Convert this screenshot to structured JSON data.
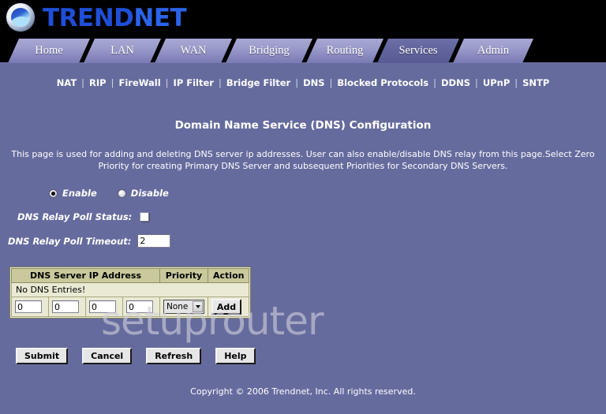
{
  "brand": {
    "logo_icon": "trendnet-globe-icon",
    "name_part1": "TREND",
    "name_part2": "NET",
    "full_name": "TRENDNET"
  },
  "tabs": [
    {
      "label": "Home",
      "active": false
    },
    {
      "label": "LAN",
      "active": false
    },
    {
      "label": "WAN",
      "active": false
    },
    {
      "label": "Bridging",
      "active": false
    },
    {
      "label": "Routing",
      "active": false
    },
    {
      "label": "Services",
      "active": true
    },
    {
      "label": "Admin",
      "active": false
    }
  ],
  "subnav": {
    "separator": "|",
    "items": [
      {
        "label": "NAT"
      },
      {
        "label": "RIP"
      },
      {
        "label": "FireWall"
      },
      {
        "label": "IP Filter"
      },
      {
        "label": "Bridge Filter"
      },
      {
        "label": "DNS"
      },
      {
        "label": "Blocked Protocols"
      },
      {
        "label": "DDNS"
      },
      {
        "label": "UPnP"
      },
      {
        "label": "SNTP"
      }
    ]
  },
  "page": {
    "title": "Domain Name Service (DNS) Configuration",
    "description": "This page is used for adding and deleting DNS server ip addresses. User can also enable/disable DNS relay from this page.Select Zero Priority for creating Primary DNS Server and subsequent Priorities for Secondary DNS Servers."
  },
  "form": {
    "relay_enable": {
      "enable_label": "Enable",
      "disable_label": "Disable",
      "selected": "Enable"
    },
    "poll_status": {
      "label": "DNS Relay Poll Status:",
      "checked": false
    },
    "poll_timeout": {
      "label": "DNS Relay Poll Timeout:",
      "value": "2"
    }
  },
  "dns_table": {
    "headers": [
      "DNS Server IP Address",
      "Priority",
      "Action"
    ],
    "empty_message": "No DNS Entries!",
    "rows": [],
    "entry_row": {
      "octets": [
        "0",
        "0",
        "0",
        "0"
      ],
      "priority_value": "None",
      "priority_options": [
        "None"
      ],
      "add_label": "Add"
    }
  },
  "actions": {
    "submit_label": "Submit",
    "cancel_label": "Cancel",
    "refresh_label": "Refresh",
    "help_label": "Help"
  },
  "watermark": "setuprouter",
  "footer": {
    "copyright": "Copyright © 2006 Trendnet, Inc. All rights reserved."
  },
  "colors": {
    "page_background": "#666b9e",
    "header_background": "#000000",
    "tab_inactive": "#9e9ecd",
    "tab_active": "#63659e",
    "table_header": "#c9c99c",
    "table_body": "#eaead4",
    "brand_blue": "#1f4fd8"
  }
}
